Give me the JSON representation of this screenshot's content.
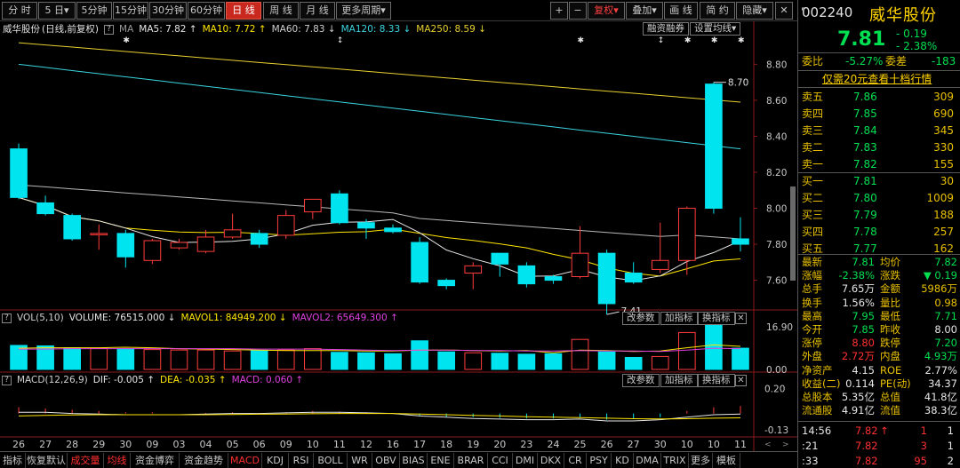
{
  "toolbar": {
    "periods": [
      "分 时",
      "5 日▾",
      "5分钟",
      "15分钟",
      "30分钟",
      "60分钟",
      "日 线",
      "周 线",
      "月 线",
      "更多周期▾"
    ],
    "active_period": "日 线",
    "plus": "+",
    "minus": "−",
    "adjust": "复权▾",
    "overlay": "叠加▾",
    "draw": "画 线",
    "simple": "简 约",
    "hide": "隐藏▾",
    "win_close": "✕"
  },
  "price_legend": {
    "title": "威华股份",
    "mode": "(日线,前复权)",
    "ma_label": "MA",
    "ma5": "MA5: 7.82 ↑",
    "ma10": "MA10: 7.72 ↑",
    "ma60": "MA60: 7.83 ↓",
    "ma120": "MA120: 8.33 ↓",
    "ma250": "MA250: 8.59 ↓",
    "btn_margin": "融资融券",
    "btn_ma": "设置均线▾"
  },
  "vol_legend": {
    "name": "VOL(5,10)",
    "volume": "VOLUME: 76515.000 ↓",
    "mavol1": "MAVOL1: 84949.200 ↓",
    "mavol2": "MAVOL2: 65649.300 ↑",
    "btn_param": "改参数",
    "btn_add": "加指标",
    "btn_swap": "换指标",
    "close": "✕"
  },
  "macd_legend": {
    "name": "MACD(12,26,9)",
    "dif": "DIF: -0.005 ↑",
    "dea": "DEA: -0.035 ↑",
    "macd": "MACD: 0.060 ↑",
    "btn_param": "改参数",
    "btn_add": "加指标",
    "btn_swap": "换指标",
    "close": "✕"
  },
  "colors": {
    "up": "#ff3c3c",
    "down": "#00e4f0",
    "ma5": "#e6e6e6",
    "ma10": "#ffe600",
    "ma60": "#b8b8b8",
    "ma120": "#3ad4e0",
    "ma250": "#e8d030",
    "mavol1": "#ffe600",
    "mavol2": "#e040e0",
    "dif": "#e6e6e6",
    "dea": "#ffe600"
  },
  "chart_data": {
    "type": "candlestick",
    "price_axis": {
      "ticks": [
        "8.80",
        "8.60",
        "8.40",
        "8.20",
        "8.00",
        "7.80",
        "7.60"
      ],
      "ylim": [
        7.44,
        8.95
      ]
    },
    "volume_axis": {
      "ticks": [
        "16.90",
        "0.00"
      ],
      "max": 16.9
    },
    "macd_axis": {
      "ticks": [
        "0.20",
        "-0.13"
      ],
      "ylim": [
        -0.16,
        0.24
      ]
    },
    "x_labels": [
      "26",
      "27",
      "28",
      "29",
      "30",
      "09",
      "03",
      "04",
      "05",
      "06",
      "09",
      "10",
      "11",
      "12",
      "16",
      "17",
      "18",
      "19",
      "20",
      "23",
      "24",
      "25",
      "26",
      "27",
      "30",
      "10",
      "10",
      "11"
    ],
    "annotations": {
      "high": "8.70",
      "low": "7.41"
    },
    "candles": [
      {
        "o": 8.33,
        "h": 8.36,
        "l": 8.05,
        "c": 8.06
      },
      {
        "o": 8.03,
        "h": 8.07,
        "l": 7.96,
        "c": 7.97
      },
      {
        "o": 7.96,
        "h": 7.97,
        "l": 7.82,
        "c": 7.83
      },
      {
        "o": 7.86,
        "h": 7.91,
        "l": 7.77,
        "c": 7.86
      },
      {
        "o": 7.86,
        "h": 7.88,
        "l": 7.67,
        "c": 7.73
      },
      {
        "o": 7.71,
        "h": 7.83,
        "l": 7.69,
        "c": 7.82
      },
      {
        "o": 7.78,
        "h": 7.83,
        "l": 7.77,
        "c": 7.81
      },
      {
        "o": 7.76,
        "h": 7.88,
        "l": 7.75,
        "c": 7.84
      },
      {
        "o": 7.84,
        "h": 7.97,
        "l": 7.83,
        "c": 7.88
      },
      {
        "o": 7.86,
        "h": 7.88,
        "l": 7.78,
        "c": 7.8
      },
      {
        "o": 7.85,
        "h": 7.99,
        "l": 7.83,
        "c": 7.96
      },
      {
        "o": 7.98,
        "h": 8.02,
        "l": 7.94,
        "c": 8.05
      },
      {
        "o": 8.08,
        "h": 8.1,
        "l": 7.91,
        "c": 7.92
      },
      {
        "o": 7.92,
        "h": 7.94,
        "l": 7.83,
        "c": 7.89
      },
      {
        "o": 7.89,
        "h": 7.91,
        "l": 7.86,
        "c": 7.87
      },
      {
        "o": 7.81,
        "h": 7.84,
        "l": 7.58,
        "c": 7.59
      },
      {
        "o": 7.6,
        "h": 7.61,
        "l": 7.55,
        "c": 7.57
      },
      {
        "o": 7.64,
        "h": 7.7,
        "l": 7.55,
        "c": 7.68
      },
      {
        "o": 7.75,
        "h": 7.75,
        "l": 7.62,
        "c": 7.69
      },
      {
        "o": 7.68,
        "h": 7.7,
        "l": 7.56,
        "c": 7.58
      },
      {
        "o": 7.62,
        "h": 7.63,
        "l": 7.58,
        "c": 7.6
      },
      {
        "o": 7.62,
        "h": 7.9,
        "l": 7.61,
        "c": 7.75
      },
      {
        "o": 7.75,
        "h": 7.77,
        "l": 7.41,
        "c": 7.47
      },
      {
        "o": 7.64,
        "h": 7.7,
        "l": 7.58,
        "c": 7.59
      },
      {
        "o": 7.66,
        "h": 7.92,
        "l": 7.64,
        "c": 7.71
      },
      {
        "o": 7.71,
        "h": 8.01,
        "l": 7.63,
        "c": 8.0
      },
      {
        "o": 8.69,
        "h": 8.7,
        "l": 7.97,
        "c": 8.0
      },
      {
        "o": 7.83,
        "h": 7.95,
        "l": 7.76,
        "c": 7.8
      }
    ],
    "volume": [
      0.52,
      0.51,
      0.47,
      0.46,
      0.45,
      0.43,
      0.42,
      0.42,
      0.4,
      0.41,
      0.42,
      0.45,
      0.37,
      0.36,
      0.34,
      0.62,
      0.38,
      0.36,
      0.35,
      0.33,
      0.34,
      0.65,
      0.38,
      0.26,
      0.28,
      0.8,
      1.0,
      0.46
    ],
    "mavol1": [
      0.46,
      0.47,
      0.47,
      0.47,
      0.48,
      0.47,
      0.45,
      0.44,
      0.43,
      0.42,
      0.41,
      0.41,
      0.41,
      0.4,
      0.4,
      0.42,
      0.42,
      0.41,
      0.4,
      0.41,
      0.36,
      0.42,
      0.41,
      0.39,
      0.4,
      0.47,
      0.53,
      0.5
    ],
    "mavol2": [
      0.44,
      0.44,
      0.45,
      0.45,
      0.45,
      0.45,
      0.45,
      0.45,
      0.45,
      0.44,
      0.44,
      0.44,
      0.43,
      0.42,
      0.41,
      0.42,
      0.42,
      0.41,
      0.41,
      0.4,
      0.4,
      0.41,
      0.4,
      0.4,
      0.39,
      0.42,
      0.46,
      0.45
    ],
    "macd_hist": [
      0.05,
      0.04,
      0.03,
      0.02,
      0.01,
      0.01,
      0.0,
      0.005,
      0.01,
      0.005,
      0.01,
      0.02,
      0.015,
      0.01,
      0.0,
      -0.02,
      -0.03,
      -0.03,
      -0.035,
      -0.04,
      -0.04,
      -0.03,
      -0.05,
      -0.045,
      -0.03,
      0.02,
      0.05,
      0.06
    ],
    "dif": [
      0.01,
      0.01,
      0.0,
      -0.005,
      -0.01,
      -0.01,
      -0.01,
      -0.005,
      0.0,
      0.0,
      0.005,
      0.01,
      0.01,
      0.005,
      0.0,
      -0.02,
      -0.03,
      -0.04,
      -0.045,
      -0.05,
      -0.05,
      -0.045,
      -0.06,
      -0.06,
      -0.05,
      -0.03,
      -0.01,
      -0.005
    ],
    "dea": [
      -0.02,
      -0.015,
      -0.012,
      -0.01,
      -0.01,
      -0.01,
      -0.01,
      -0.01,
      -0.008,
      -0.006,
      -0.004,
      -0.002,
      0.0,
      0.0,
      0.0,
      -0.005,
      -0.01,
      -0.015,
      -0.02,
      -0.026,
      -0.03,
      -0.033,
      -0.038,
      -0.042,
      -0.044,
      -0.042,
      -0.038,
      -0.035
    ]
  },
  "right_panel": {
    "code": "002240",
    "name": "威华股份",
    "price": "7.81",
    "change": "- 0.19",
    "change_pct": "- 2.38%",
    "wb_label": "委比",
    "wb_value": "-5.27%",
    "wc_label": "委差",
    "wc_value": "-183",
    "promo": "仅需20元查看十档行情",
    "sells": [
      {
        "label": "卖五",
        "price": "7.86",
        "vol": "309"
      },
      {
        "label": "卖四",
        "price": "7.85",
        "vol": "690"
      },
      {
        "label": "卖三",
        "price": "7.84",
        "vol": "345"
      },
      {
        "label": "卖二",
        "price": "7.83",
        "vol": "330"
      },
      {
        "label": "卖一",
        "price": "7.82",
        "vol": "155"
      }
    ],
    "buys": [
      {
        "label": "买一",
        "price": "7.81",
        "vol": "30"
      },
      {
        "label": "买二",
        "price": "7.80",
        "vol": "1009"
      },
      {
        "label": "买三",
        "price": "7.79",
        "vol": "188"
      },
      {
        "label": "买四",
        "price": "7.78",
        "vol": "257"
      },
      {
        "label": "买五",
        "price": "7.77",
        "vol": "162"
      }
    ],
    "stats": [
      {
        "l1": "最新",
        "v1": "7.81",
        "c1": "green",
        "l2": "均价",
        "v2": "7.82",
        "c2": "green"
      },
      {
        "l1": "涨幅",
        "v1": "-2.38%",
        "c1": "green",
        "l2": "涨跌",
        "v2": "▼ 0.19",
        "c2": "green"
      },
      {
        "l1": "总手",
        "v1": "7.65万",
        "c1": "white",
        "l2": "金额",
        "v2": "5986万",
        "c2": "gold"
      },
      {
        "l1": "换手",
        "v1": "1.56%",
        "c1": "white",
        "l2": "量比",
        "v2": "0.98",
        "c2": "gold"
      },
      {
        "l1": "最高",
        "v1": "7.95",
        "c1": "green",
        "l2": "最低",
        "v2": "7.71",
        "c2": "green"
      },
      {
        "l1": "今开",
        "v1": "7.85",
        "c1": "green",
        "l2": "昨收",
        "v2": "8.00",
        "c2": "white"
      },
      {
        "l1": "涨停",
        "v1": "8.80",
        "c1": "red",
        "l2": "跌停",
        "v2": "7.20",
        "c2": "green"
      },
      {
        "l1": "外盘",
        "v1": "2.72万",
        "c1": "red",
        "l2": "内盘",
        "v2": "4.93万",
        "c2": "green"
      },
      {
        "l1": "净资产",
        "v1": "4.15",
        "c1": "white",
        "l2": "ROE",
        "v2": "2.77%",
        "c2": "white"
      },
      {
        "l1": "收益(二)",
        "v1": "0.114",
        "c1": "white",
        "l2": "PE(动)",
        "v2": "34.37",
        "c2": "white"
      },
      {
        "l1": "总股本",
        "v1": "5.35亿",
        "c1": "white",
        "l2": "总值",
        "v2": "41.8亿",
        "c2": "white"
      },
      {
        "l1": "流通股",
        "v1": "4.91亿",
        "c1": "white",
        "l2": "流值",
        "v2": "38.3亿",
        "c2": "white"
      }
    ],
    "ticks": [
      {
        "time": "14:56",
        "price": "7.82",
        "arrow": "↑",
        "vol": "1",
        "num": "1"
      },
      {
        "time": ":21",
        "price": "7.82",
        "arrow": "",
        "vol": "3",
        "num": "1"
      },
      {
        "time": ":33",
        "price": "7.82",
        "arrow": "",
        "vol": "95",
        "num": "2"
      }
    ]
  },
  "tabs": [
    "指标",
    "恢复默认",
    "成交量",
    "均线",
    "资金博弈",
    "资金趋势",
    "MACD",
    "KDJ",
    "RSI",
    "BOLL",
    "WR",
    "OBV",
    "BIAS",
    "ENE",
    "BRAR",
    "CCI",
    "DMI",
    "DKX",
    "CR",
    "PSY",
    "KD",
    "DMA",
    "TRIX",
    "更多",
    "模板"
  ],
  "tabs_selected": [
    "成交量",
    "均线",
    "MACD"
  ]
}
